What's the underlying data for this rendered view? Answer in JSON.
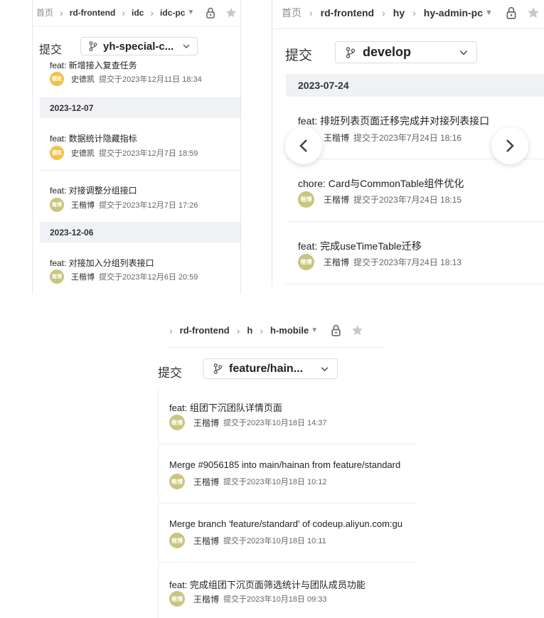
{
  "panel1": {
    "breadcrumb": {
      "home": "首页",
      "items": [
        "rd-frontend",
        "idc",
        "idc-pc"
      ]
    },
    "submit_label": "提交",
    "branch": "yh-special-c...",
    "partial_title": "feat: 新增接入复查任务",
    "partial_author": "史德凯",
    "partial_time": "提交于2023年12月11日 18:34",
    "groups": [
      {
        "date": "2023-12-07",
        "commits": [
          {
            "title": "feat: 数据统计隐藏指标",
            "author": "史德凯",
            "avatar": "德凯",
            "time": "提交于2023年12月7日 18:59"
          },
          {
            "title": "feat: 对接调整分组接口",
            "author": "王楷博",
            "avatar": "楷博",
            "time": "提交于2023年12月7日 17:26"
          }
        ]
      },
      {
        "date": "2023-12-06",
        "commits": [
          {
            "title": "feat: 对接加入分组列表接口",
            "author": "王楷博",
            "avatar": "楷博",
            "time": "提交于2023年12月6日 20:59"
          }
        ]
      }
    ]
  },
  "panel2": {
    "breadcrumb": {
      "home": "首页",
      "items": [
        "rd-frontend",
        "hy",
        "hy-admin-pc"
      ]
    },
    "submit_label": "提交",
    "branch": "develop",
    "date": "2023-07-24",
    "commits": [
      {
        "title": "feat: 排班列表页面迁移完成并对接列表接口",
        "author": "王楷博",
        "avatar": "楷博",
        "time": "提交于2023年7月24日 18:16"
      },
      {
        "title": "chore: Card与CommonTable组件优化",
        "author": "王楷博",
        "avatar": "楷博",
        "time": "提交于2023年7月24日 18:15"
      },
      {
        "title": "feat: 完成useTimeTable迁移",
        "author": "王楷博",
        "avatar": "楷博",
        "time": "提交于2023年7月24日 18:13"
      }
    ]
  },
  "panel3": {
    "breadcrumb": {
      "items": [
        "rd-frontend",
        "h",
        "h-mobile"
      ]
    },
    "submit_label": "提交",
    "branch": "feature/hain...",
    "commits": [
      {
        "title": "feat: 组团下沉团队详情页面",
        "author": "王楷博",
        "avatar": "楷博",
        "time": "提交于2023年10月18日 14:37"
      },
      {
        "title": "Merge #9056185 into main/hainan from feature/standard",
        "author": "王楷博",
        "avatar": "楷博",
        "time": "提交于2023年10月18日 10:12"
      },
      {
        "title": "Merge branch 'feature/standard' of codeup.aliyun.com:gu",
        "author": "王楷博",
        "avatar": "楷博",
        "time": "提交于2023年10月18日 10:11"
      },
      {
        "title": "feat: 完成组团下沉页面筛选统计与团队成员功能",
        "author": "王楷博",
        "avatar": "楷博",
        "time": "提交于2023年10月18日 09:33"
      }
    ]
  },
  "icons": {
    "lock": "lock-icon",
    "star": "star-icon",
    "branch": "branch-icon",
    "chevron": "chevron-down-icon"
  },
  "colors": {
    "date_row_bg": "#eff1f4",
    "avatar_yellow": "#f2c24a",
    "avatar_olive": "#c9c57d"
  }
}
